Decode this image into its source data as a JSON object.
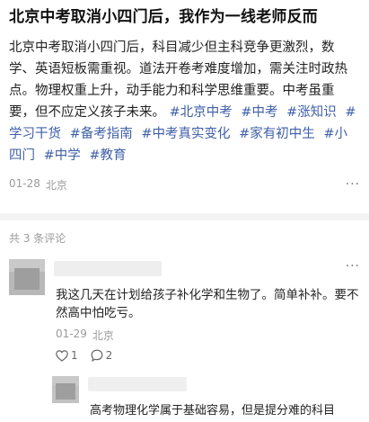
{
  "post": {
    "title": "北京中考取消小四门后，我作为一线老师反而",
    "body": "北京中考取消小四门后，科目减少但主科竞争更激烈，数学、英语短板需重视。道法开卷考难度增加，需关注时政热点。物理权重上升，动手能力和科学思维重要。中考虽重要，但不应定义孩子未来。",
    "hashtags": [
      "#北京中考",
      "#中考",
      "#涨知识",
      "#学习干货",
      "#备考指南",
      "#中考真实变化",
      "#家有初中生",
      "#小四门",
      "#中学",
      "#教育"
    ],
    "date": "01-28",
    "location": "北京"
  },
  "comments_header": "共 3 条评论",
  "comments": [
    {
      "text": "我这几天在计划给孩子补化学和生物了。简单补补。要不然高中怕吃亏。",
      "date": "01-29",
      "location": "北京",
      "likes": "1",
      "replies": "2"
    }
  ],
  "reply": {
    "text": "高考物理化学属于基础容易，但是提分难的科目"
  },
  "icons": {
    "more": "more-dots-icon",
    "like": "heart-icon",
    "reply": "comment-bubble-icon"
  },
  "colors": {
    "hashtag": "#3f5fa8",
    "meta": "#9a9a9a",
    "divider": "#f4f4f4"
  }
}
